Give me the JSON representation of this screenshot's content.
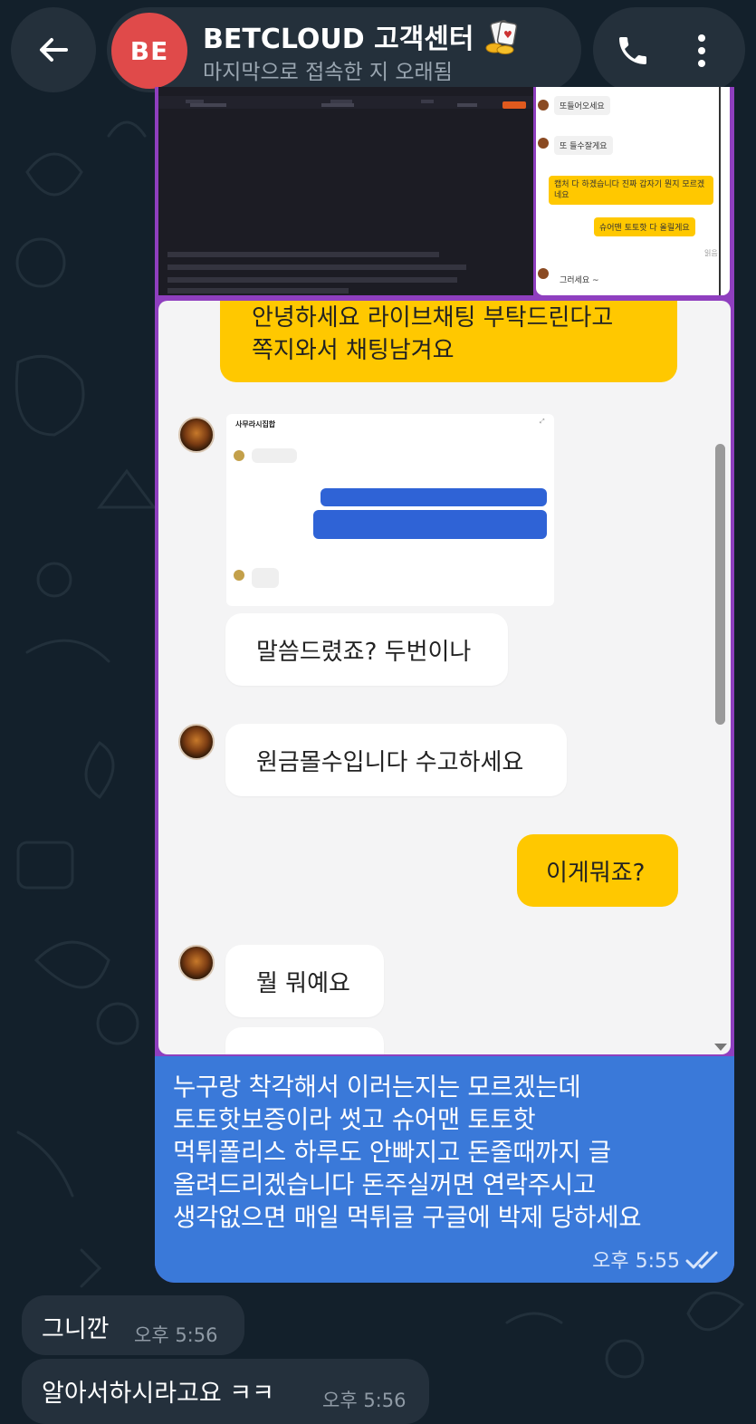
{
  "header": {
    "avatar_initials": "BE",
    "title": "BETCLOUD 고객센터",
    "title_icon": "playing-cards-coins-emoji",
    "status": "마지막으로 접속한 지 오래됨",
    "back_icon": "arrow-left-icon",
    "call_icon": "phone-icon",
    "menu_icon": "kebab-menu-icon"
  },
  "forwarded_image": {
    "right_panel": {
      "messages": [
        {
          "side": "left",
          "text": "또들어오세요"
        },
        {
          "side": "left",
          "text": "또 들수잘게요"
        },
        {
          "side": "right",
          "text": "캡처 다 하겠습니다 진짜 갑자기 뭔지 모르겠네요"
        },
        {
          "side": "right",
          "text": "슈어맨 토토핫 다 올릴게요"
        },
        {
          "side": "left",
          "text": "그러세요 ~"
        }
      ],
      "read_label": "읽음"
    },
    "phone": {
      "top_bubble_line1": "안녕하세요 라이브채팅 부탁드린다고",
      "top_bubble_line2": "쪽지와서 채팅남겨요",
      "mini_card_title": "사무라시집합",
      "msg1": "말씀드렸죠? 두번이나",
      "msg2": "원금몰수입니다 수고하세요",
      "my_msg": "이게뭐죠?",
      "msg3": "뭘 뭐예요"
    }
  },
  "caption": {
    "text": "누구랑 착각해서 이러는지는 모르겠는데\n토토핫보증이라 썻고 슈어맨 토토핫\n먹튀폴리스 하루도 안빠지고 돈줄때까지 글\n올려드리겠습니다 돈주실꺼면 연락주시고\n생각없으면 매일 먹튀글 구글에 박제 당하세요",
    "time": "오후 5:55",
    "status_icon": "double-check-icon"
  },
  "incoming": [
    {
      "text": "그니깐",
      "time": "오후 5:56"
    },
    {
      "text": "알아서하시라고요 ㅋㅋ",
      "time": "오후 5:56"
    }
  ],
  "colors": {
    "background": "#13202b",
    "avatar": "#e04a4a",
    "outgoing_bubble": "#3a79d9",
    "incoming_bubble": "#24303c",
    "kakao_yellow": "#ffc800"
  }
}
